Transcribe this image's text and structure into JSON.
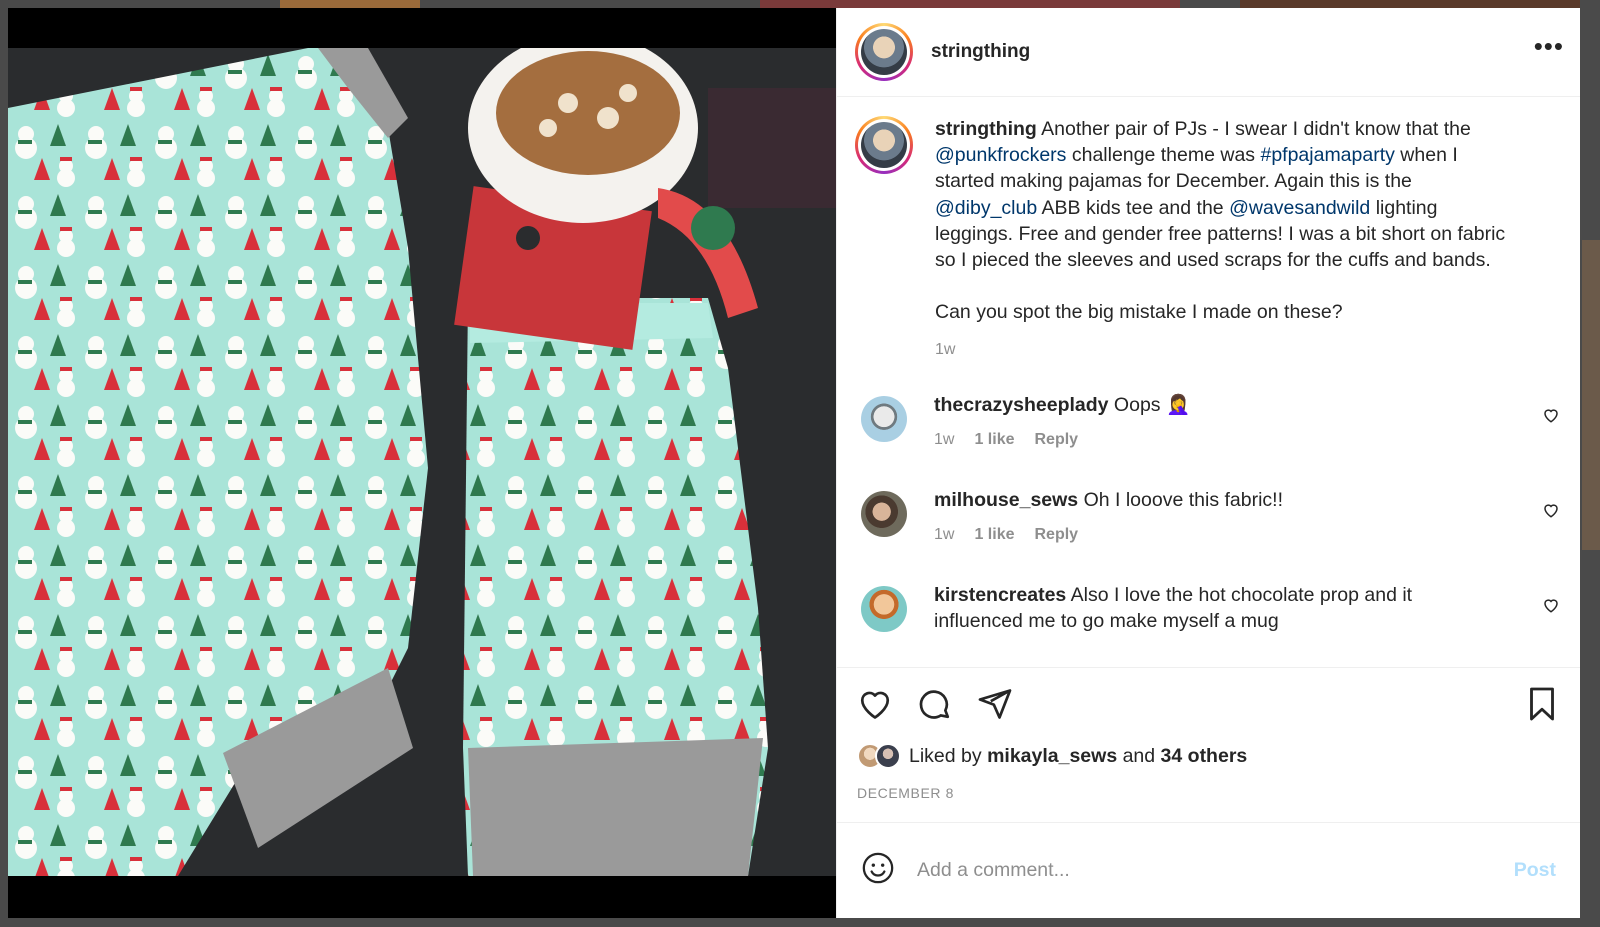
{
  "post": {
    "username": "stringthing",
    "more_icon": "more-horizontal-icon"
  },
  "caption": {
    "username": "stringthing",
    "text_1": " Another pair of PJs - I swear I didn't know that the ",
    "mention_1": "@punkfrockers",
    "text_2": " challenge theme was ",
    "hashtag_1": "#pfpajamaparty",
    "text_3": " when I started making pajamas for December. Again this is the ",
    "mention_2": "@diby_club",
    "text_4": " ABB kids tee and the ",
    "mention_3": "@wavesandwild",
    "text_5": " lighting leggings. Free and gender free patterns! I was a bit short on fabric so I pieced the sleeves and used scraps for the cuffs and bands.",
    "text_6": "Can you spot the big mistake I made on these?",
    "time": "1w"
  },
  "comments": [
    {
      "username": "thecrazysheeplady",
      "text": " Oops 🤦‍♀️",
      "time": "1w",
      "likes": "1 like",
      "reply": "Reply",
      "avatar_color": "#a9cfe3"
    },
    {
      "username": "milhouse_sews",
      "text": " Oh I looove this fabric!!",
      "time": "1w",
      "likes": "1 like",
      "reply": "Reply",
      "avatar_color": "#6e6a5c"
    },
    {
      "username": "kirstencreates",
      "text": " Also I love the hot chocolate prop and it influenced me to go make myself a mug",
      "avatar_color": "#7ec9c6"
    }
  ],
  "actions": {
    "liked_prefix": "Liked by ",
    "liked_user": "mikayla_sews",
    "liked_and": " and ",
    "liked_others": "34 others",
    "date": "DECEMBER 8"
  },
  "composer": {
    "placeholder": "Add a comment...",
    "post_label": "Post"
  },
  "colors": {
    "link": "#00376b",
    "muted": "#8e8e8e",
    "post_disabled": "#b2dffc",
    "fabric": "#a9e4d8"
  }
}
